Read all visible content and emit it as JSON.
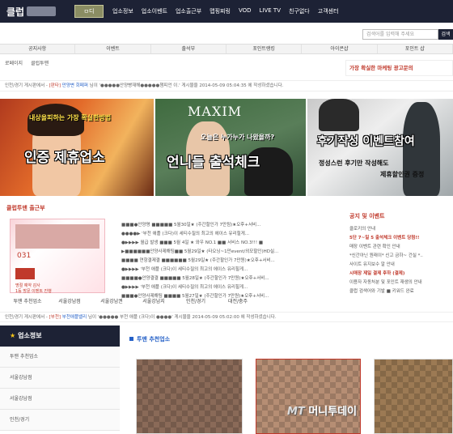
{
  "site": {
    "logo_text": "클럽",
    "home_label": "ㅁ디"
  },
  "topnav": [
    "업소정보",
    "업소이벤트",
    "업소출근부",
    "맵핑찌링",
    "VOD",
    "LIVE TV",
    "친구없다",
    "고객센터"
  ],
  "search": {
    "placeholder": "검색어를 입력해 주세요",
    "button": "검색"
  },
  "menubar": [
    "공지사항",
    "이벤트",
    "출석부",
    "포인트랭킹",
    "아이콘샵",
    "포인트 샵"
  ],
  "crumbs": [
    "로페이지",
    "클럽투맨"
  ],
  "ad": {
    "text_pre": "가장 확실한 마케팅 광고문의"
  },
  "ticker1": {
    "prefix": "인천/경기 게시판에서 -",
    "cat": "[판타]",
    "hl": "만양변 회페퍼",
    "rest": "님이 '●●●●●안양빵재해●●●●●챔피언 이.' 게시물을 2014-05-09 05:04:35 에 작성하셨습니다."
  },
  "banners": {
    "b1_sub": "내상을피하는 가장 확실한방법",
    "b1_title": "인증 제휴업소",
    "b2_logo": "MAXIM",
    "b2_sub": "오늘은 누가누가 나왔을까?",
    "b2_title": "언니들 출석체크",
    "b3_title": "후기작성 이벤트참여",
    "b3_sub1": "정성스런 후기만 작성해도",
    "b3_sub2": "제휴할인권 증정"
  },
  "section1": {
    "title": "클럽투맨 출근부"
  },
  "sitemenu_box": {
    "row1": "031",
    "row2": "명절 예약 감사",
    "row3": "1등 방문 이벤트 진행"
  },
  "notices": [
    "■■■●안양명 ■■■■■ 5월30일★ (주간할인가 7만됨)★오후+서비...",
    "●●●●▶ '부천 애플 (크다)이 세티수질의 최고의 에이스 유리힐게...",
    "●▶▶▶▶ 월급 발생 ■■■ 5월 4일 ★ 와우 NO.1 ■■ 서비스 NO.3!!! ■",
    "▶■■■■■■안양사제해팀■■ 5월29일★ (타오닝~1만event/외모할인)HD실...",
    "■■■■ 연항결제결 ■■■■■■ 5월29일★ (주간할인가 7만원)★오후+서비...",
    "●▶▶▶▶ '부천 애플 (크다)이 세티수질의 최고의 에이스 유리힐게...",
    "■■■■●안양결결 ■■■■■ 5월28일★ (주간할인가 7만원)★오후+서비...",
    "●▶▶▶▶ '부천 애플 (크다)이 세티수질의 최고의 에이스 유리힐게...",
    "■■■●안양사제해팀 ■■■■ 5월27일★ (주간할인가 7만원)★오후+서비..."
  ],
  "events": {
    "title": "공지 및 이벤트",
    "items": [
      {
        "text": "클로키의 안내",
        "red": false
      },
      {
        "text": "5단 7~일 5 출석체크 이벤트 당첨!!",
        "red": true
      },
      {
        "text": "매장 이벤트 관련 확인 안내",
        "red": false
      },
      {
        "text": "*신간아닌 원래이* 신고 금하~ 건실 *..",
        "red": false
      },
      {
        "text": "사이트 유지보수 알 안내",
        "red": false
      },
      {
        "text": "시매장 제일 결제 후하 (결제)",
        "red": true
      },
      {
        "text": "이용자 자동처분 및 포인트 재생의 안내",
        "red": false
      },
      {
        "text": "클럽 검색어와 기발 ■ 키워드 완료",
        "red": false
      }
    ]
  },
  "tabs": [
    "투맨 추천업소",
    "서울강남점",
    "서울강남권",
    "서울강남지",
    "인천/경기",
    "대전/충주"
  ],
  "ticker2": {
    "prefix": "인천/경기 게시판에서 -",
    "cat": "[부천]",
    "hl": "부천애플밸리",
    "rest": "님이 '●●●●● 부천 애플 (크다)이 ●●●●' 게시물을 2014-05-09 05:02:00 에 작성하셨습니다."
  },
  "sidebar": {
    "title": "업소정보",
    "items": [
      "투맨 추천업소",
      "서울강남점",
      "서울강남점",
      "인천/경기",
      "대전/충주"
    ]
  },
  "recommend": {
    "title": "투맨 추천업소"
  },
  "watermark": {
    "mt": "MT",
    "name": "머니투데이"
  }
}
